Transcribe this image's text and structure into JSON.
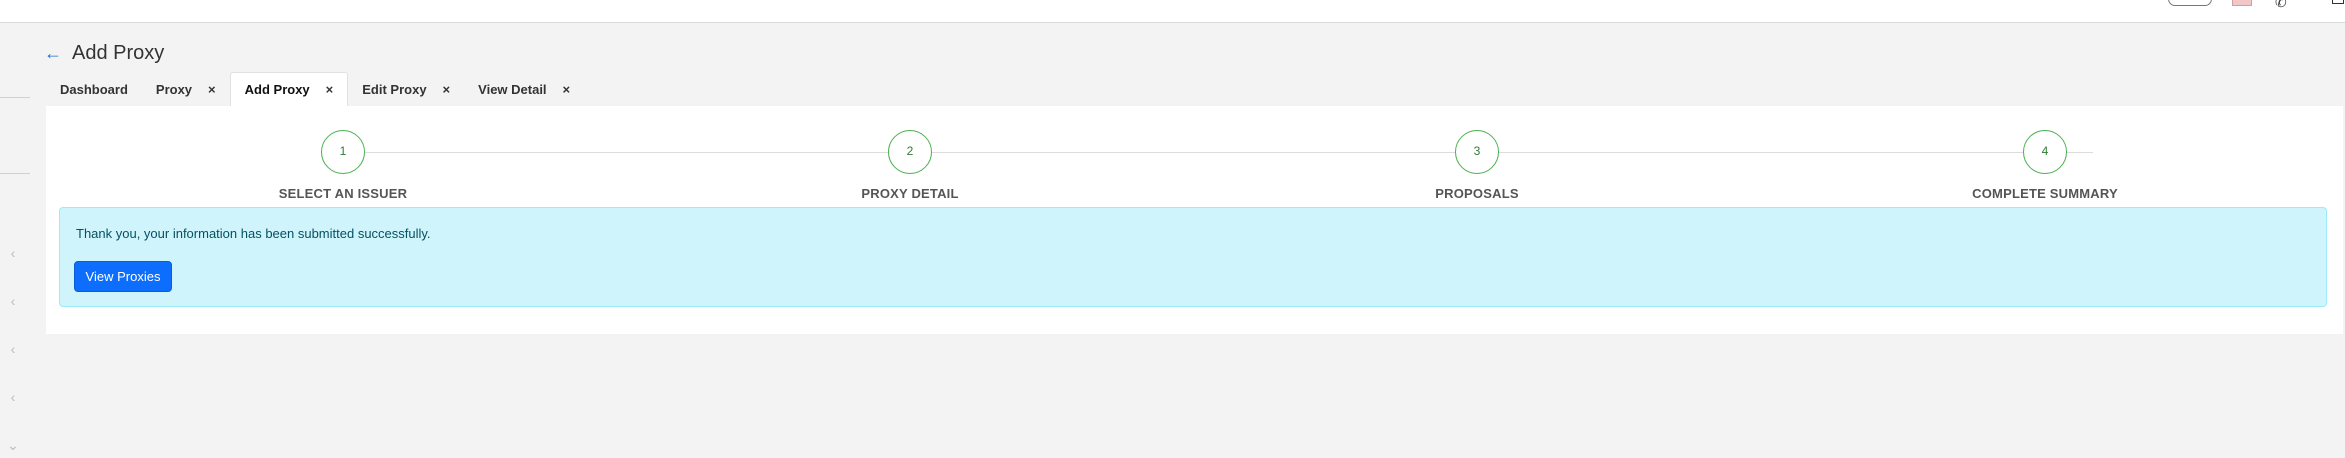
{
  "header": {
    "title": "Add Proxy",
    "back_icon": "arrow-left-icon"
  },
  "tabs": [
    {
      "label": "Dashboard",
      "closable": false,
      "active": false
    },
    {
      "label": "Proxy",
      "closable": true,
      "active": false
    },
    {
      "label": "Add Proxy",
      "closable": true,
      "active": true
    },
    {
      "label": "Edit Proxy",
      "closable": true,
      "active": false
    },
    {
      "label": "View Detail",
      "closable": true,
      "active": false
    }
  ],
  "tab_close_glyph": "×",
  "stepper": {
    "steps": [
      {
        "number": "1",
        "label": "SELECT AN ISSUER"
      },
      {
        "number": "2",
        "label": "PROXY DETAIL"
      },
      {
        "number": "3",
        "label": "PROPOSALS"
      },
      {
        "number": "4",
        "label": "COMPLETE SUMMARY"
      }
    ],
    "accent_color": "#4caf50"
  },
  "alert": {
    "message": "Thank you, your information has been submitted successfully.",
    "button_label": "View Proxies",
    "background_color": "#cff4fc",
    "button_color": "#0d6efd"
  },
  "sidebar": {
    "icons": [
      "chevron-left-icon",
      "chevron-left-icon",
      "chevron-left-icon",
      "chevron-left-icon",
      "chevron-down-icon"
    ]
  }
}
